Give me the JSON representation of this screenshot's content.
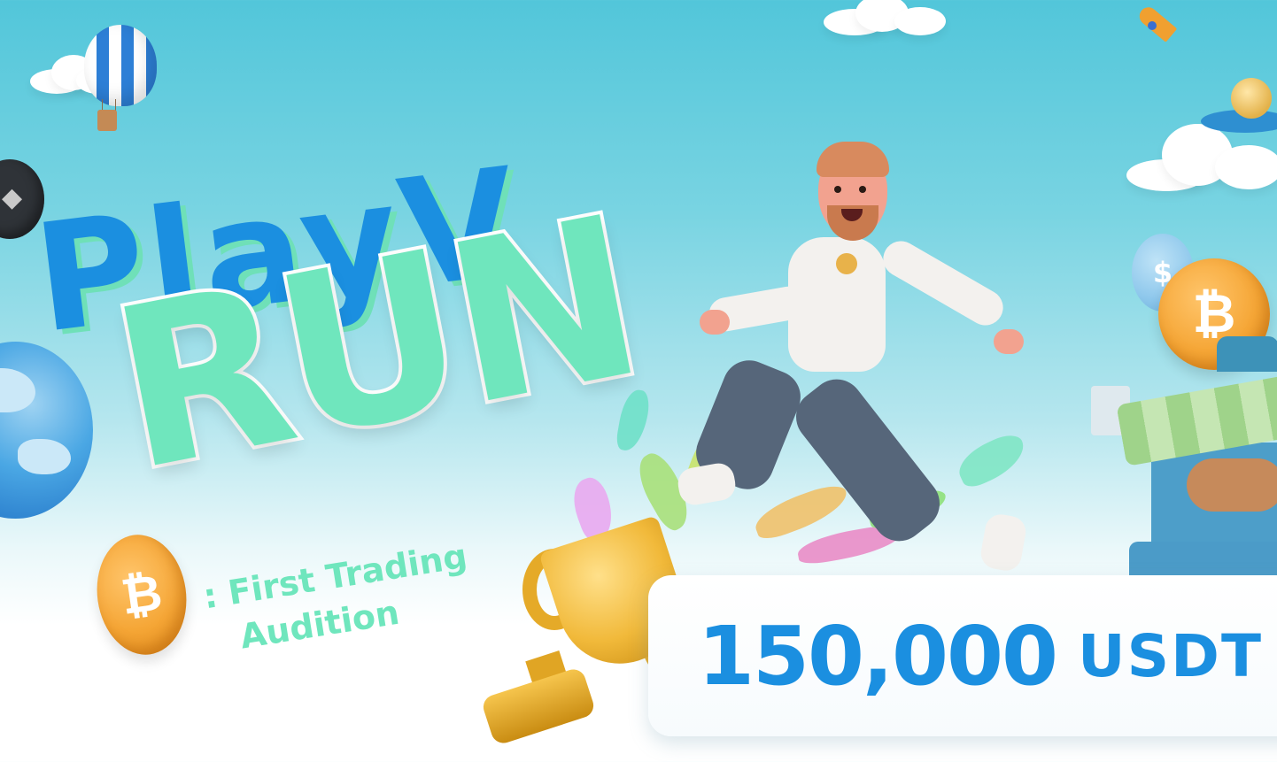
{
  "banner": {
    "title_line1": "PlayV",
    "title_line2": "RUN",
    "subtitle_line1": ": First Trading",
    "subtitle_line2": "Audition",
    "prize_amount": "150,000",
    "prize_unit": "USDT"
  },
  "icons": {
    "coin_left": "bitcoin-coin-icon",
    "coin_right": "bitcoin-coin-icon",
    "coin_blue": "dollar-coin-icon",
    "eth": "ethereum-coin-icon",
    "trophy": "trophy-icon",
    "balloon": "hot-air-balloon-icon",
    "rocket": "rocket-icon",
    "globe": "globe-icon"
  },
  "glyphs": {
    "bitcoin": "₿",
    "dollar": "$",
    "eth": "◆"
  },
  "colors": {
    "title_blue": "#1b8fe0",
    "title_mint": "#6fe6bd",
    "sky_top": "#52c6da",
    "prize_text": "#1b8fe0"
  }
}
